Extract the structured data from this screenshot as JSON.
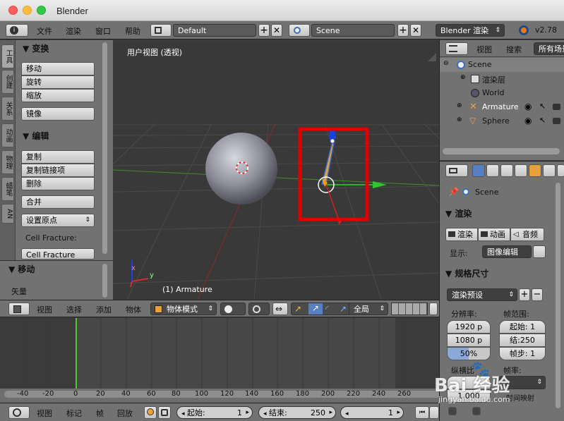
{
  "window": {
    "title": "Blender"
  },
  "infobar": {
    "menus": [
      "文件",
      "渲染",
      "窗口",
      "帮助"
    ],
    "screen_layout": "Default",
    "scene": "Scene",
    "engine": "Blender 渲染",
    "version": "v2.78"
  },
  "toolshelf": {
    "tabs": [
      "工具",
      "创建",
      "关系",
      "动画",
      "物理",
      "蜡笔",
      "AN"
    ],
    "transform_header": "变换",
    "transform_buttons": [
      "移动",
      "旋转",
      "缩放"
    ],
    "mirror_button": "镜像",
    "edit_header": "编辑",
    "edit_buttons": [
      "复制",
      "复制链接项",
      "删除"
    ],
    "join_button": "合并",
    "set_origin": "设置原点",
    "cell_fracture_label": "Cell Fracture:",
    "cell_fracture_button": "Cell Fracture",
    "operator_header": "移动",
    "vector_label": "矢量"
  },
  "viewport": {
    "view_label": "用户视图 (透视)",
    "object_label": "(1) Armature",
    "axis_x": "x",
    "axis_y": "y",
    "highlight_color": "#e00000"
  },
  "view3d_header": {
    "menus": [
      "视图",
      "选择",
      "添加",
      "物体"
    ],
    "mode": "物体模式",
    "orientation": "全局"
  },
  "timeline": {
    "ticks": [
      "-40",
      "-20",
      "0",
      "20",
      "40",
      "60",
      "80",
      "100",
      "120",
      "140",
      "160",
      "180",
      "200",
      "220",
      "240",
      "260"
    ],
    "current_frame_color": "#4ec82c"
  },
  "timeline_header": {
    "menus": [
      "视图",
      "标记",
      "帧",
      "回放"
    ],
    "start_label": "起始:",
    "start_value": "1",
    "end_label": "结束:",
    "end_value": "250",
    "current": "1"
  },
  "outliner": {
    "menus": [
      "视图",
      "搜索"
    ],
    "filter": "所有场景",
    "items": [
      {
        "label": "Scene",
        "selected": true
      },
      {
        "label": "渲染层"
      },
      {
        "label": "World"
      },
      {
        "label": "Armature"
      },
      {
        "label": "Sphere"
      }
    ]
  },
  "properties": {
    "context": "Scene",
    "render_header": "渲染",
    "render_buttons": [
      "渲染",
      "动画",
      "音频"
    ],
    "display_label": "显示:",
    "display_value": "图像编辑",
    "dimensions_header": "规格尺寸",
    "render_presets": "渲染预设",
    "resolution_label": "分辨率:",
    "res_x": "1920 p",
    "res_y": "1080 p",
    "res_pct": "50%",
    "frame_range_label": "帧范围:",
    "frame_start": "起始: 1",
    "frame_end": "结:250",
    "frame_step": "帧步: 1",
    "aspect_label": "纵横比",
    "fps_label": "帧率:",
    "aspect_value": "1.000",
    "time_remap": "时间映射"
  },
  "watermark": {
    "text": "Bai 经验",
    "url": "jingyan.baidu.com"
  }
}
